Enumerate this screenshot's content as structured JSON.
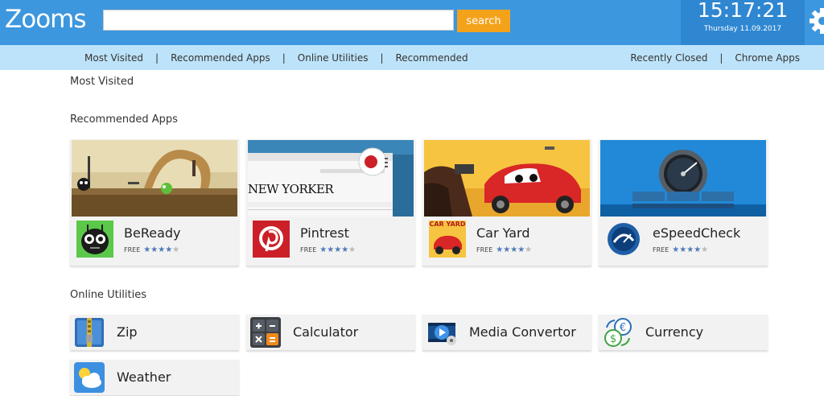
{
  "header": {
    "logo_text": "Zooms",
    "search": {
      "value": "",
      "placeholder": "",
      "button_label": "search"
    },
    "clock": {
      "time": "15:17:21",
      "date": "Thursday 11.09.2017"
    }
  },
  "nav": {
    "left": [
      "Most Visited",
      "Recommended Apps",
      "Online Utilities",
      "Recommended"
    ],
    "right": [
      "Recently Closed",
      "Chrome Apps"
    ]
  },
  "sections": {
    "most_visited": "Most Visited",
    "recommended_apps": "Recommended Apps",
    "online_utilities": "Online Utilities"
  },
  "apps": [
    {
      "name": "BeReady",
      "price": "FREE",
      "rating": 4,
      "max_rating": 5
    },
    {
      "name": "Pintrest",
      "price": "FREE",
      "rating": 4,
      "max_rating": 5
    },
    {
      "name": "Car Yard",
      "price": "FREE",
      "rating": 4,
      "max_rating": 5,
      "icon_caption": "CAR YARD"
    },
    {
      "name": "eSpeedCheck",
      "price": "FREE",
      "rating": 4,
      "max_rating": 5
    }
  ],
  "pinterest_thumb": {
    "masthead": "NEW YORKER"
  },
  "utilities": [
    {
      "label": "Zip",
      "icon": "zip-icon"
    },
    {
      "label": "Calculator",
      "icon": "calculator-icon"
    },
    {
      "label": "Media Convertor",
      "icon": "media-convertor-icon"
    },
    {
      "label": "Currency",
      "icon": "currency-icon"
    },
    {
      "label": "Weather",
      "icon": "weather-icon"
    }
  ],
  "colors": {
    "header_blue": "#3d97de",
    "clock_blue": "#2f87d2",
    "nav_blue": "#bde3fa",
    "search_orange": "#f5a21b",
    "star_blue": "#4f7ab5"
  }
}
